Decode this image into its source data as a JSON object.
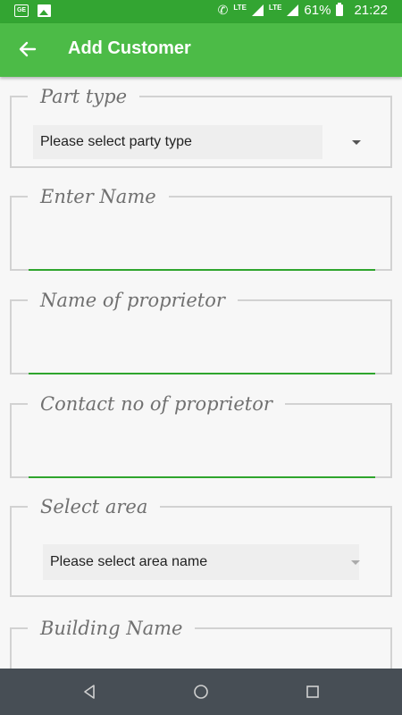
{
  "status_bar": {
    "carrier_icons": [
      "sim-icon",
      "image-icon"
    ],
    "network": "LTE",
    "network2": "LTE",
    "battery": "61%",
    "time": "21:22"
  },
  "app_bar": {
    "title": "Add Customer",
    "back_icon": "arrow-left-icon"
  },
  "form": {
    "party_type": {
      "label": "Part type",
      "selected": "Please select party type"
    },
    "name": {
      "label": "Enter Name",
      "value": ""
    },
    "proprietor": {
      "label": "Name of proprietor",
      "value": ""
    },
    "contact": {
      "label": "Contact no of proprietor",
      "value": ""
    },
    "area": {
      "label": "Select area",
      "selected": "Please select area name"
    },
    "building": {
      "label": "Building Name"
    }
  },
  "nav_bar": {
    "icons": [
      "back-triangle-icon",
      "home-circle-icon",
      "recents-square-icon"
    ]
  },
  "colors": {
    "status_bar": "#33a532",
    "app_bar": "#4cbb47",
    "underline": "#2fa52d",
    "nav_bar": "#474e55"
  }
}
